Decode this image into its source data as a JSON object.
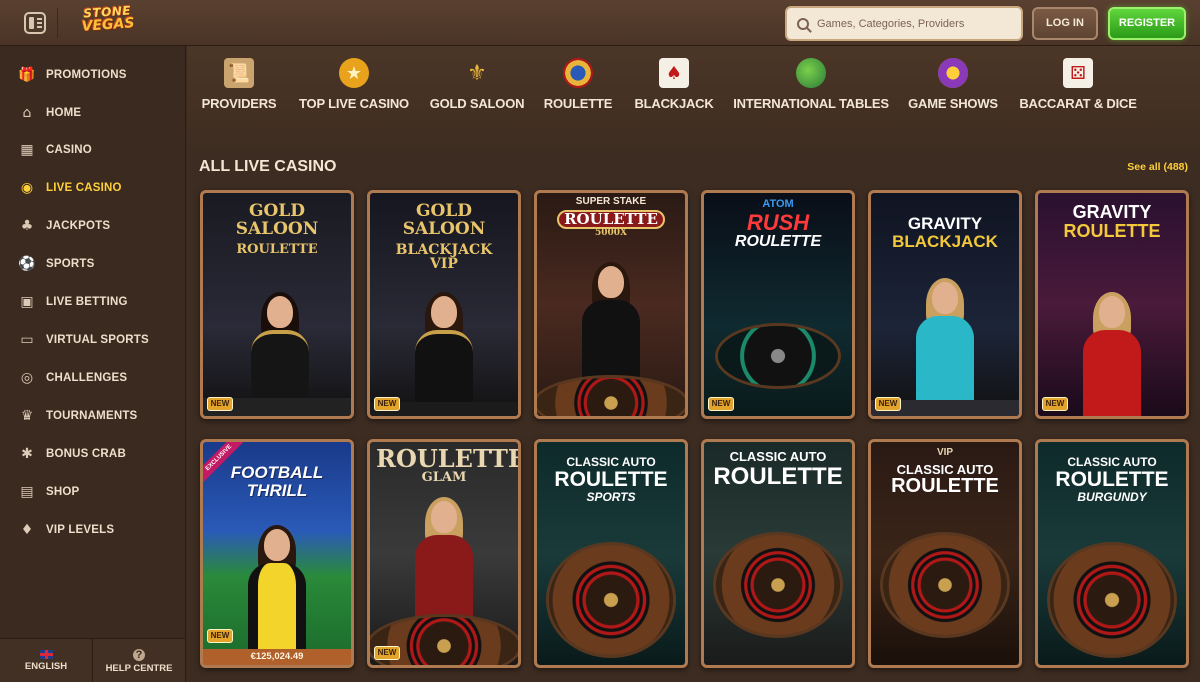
{
  "header": {
    "logo_line1": "STONE",
    "logo_line2": "VEGAS",
    "search_placeholder": "Games, Categories, Providers",
    "login_label": "LOG IN",
    "register_label": "REGISTER",
    "icons": {
      "menu": "sidebar-toggle-icon",
      "search": "search-icon"
    }
  },
  "sidebar": {
    "items": [
      {
        "label": "PROMOTIONS",
        "icon": "gift-icon",
        "active": false
      },
      {
        "label": "HOME",
        "icon": "home-icon",
        "active": false
      },
      {
        "label": "CASINO",
        "icon": "slot-machine-icon",
        "active": false
      },
      {
        "label": "LIVE CASINO",
        "icon": "live-casino-icon",
        "active": true
      },
      {
        "label": "JACKPOTS",
        "icon": "clover-icon",
        "active": false
      },
      {
        "label": "SPORTS",
        "icon": "ball-icon",
        "active": false
      },
      {
        "label": "LIVE BETTING",
        "icon": "live-betting-icon",
        "active": false
      },
      {
        "label": "VIRTUAL SPORTS",
        "icon": "virtual-sports-icon",
        "active": false
      },
      {
        "label": "CHALLENGES",
        "icon": "target-icon",
        "active": false
      },
      {
        "label": "TOURNAMENTS",
        "icon": "trophy-icon",
        "active": false
      },
      {
        "label": "BONUS CRAB",
        "icon": "crab-icon",
        "active": false
      },
      {
        "label": "SHOP",
        "icon": "shop-icon",
        "active": false
      },
      {
        "label": "VIP LEVELS",
        "icon": "vip-icon",
        "active": false
      }
    ],
    "footer": {
      "language_label": "ENGLISH",
      "help_label": "HELP CENTRE"
    }
  },
  "categories": [
    {
      "label": "PROVIDERS",
      "icon": "scroll-icon"
    },
    {
      "label": "TOP LIVE CASINO",
      "icon": "crown-badge-icon"
    },
    {
      "label": "GOLD SALOON",
      "icon": "fleur-de-lis-icon"
    },
    {
      "label": "ROULETTE",
      "icon": "roulette-icon"
    },
    {
      "label": "BLACKJACK",
      "icon": "cards-icon"
    },
    {
      "label": "INTERNATIONAL TABLES",
      "icon": "globe-icon"
    },
    {
      "label": "GAME SHOWS",
      "icon": "game-show-icon"
    },
    {
      "label": "BACCARAT & DICE",
      "icon": "dice-cards-icon"
    }
  ],
  "section": {
    "title": "ALL LIVE CASINO",
    "see_all": "See all (488)"
  },
  "games": [
    {
      "line1": "GOLD SALOON",
      "line2": "ROULETTE",
      "line3": "",
      "badge": "NEW"
    },
    {
      "line1": "GOLD SALOON",
      "line2": "BLACKJACK",
      "line3": "VIP",
      "badge": "NEW"
    },
    {
      "line1": "SUPER STAKE",
      "line2": "ROULETTE",
      "line3": "5000X",
      "badge": ""
    },
    {
      "line1": "ATOM",
      "line2": "RUSH",
      "line3": "ROULETTE",
      "badge": "NEW"
    },
    {
      "line1": "GRAVITY",
      "line2": "BLACKJACK",
      "line3": "",
      "badge": "NEW"
    },
    {
      "line1": "GRAVITY",
      "line2": "ROULETTE",
      "line3": "",
      "badge": "NEW"
    },
    {
      "line1": "FOOTBALL",
      "line2": "THRILL",
      "line3": "",
      "badge": "NEW",
      "ribbon": "EXCLUSIVE",
      "jackpot": "€125,024.49"
    },
    {
      "line1": "ROULETTE",
      "line2": "GLAM",
      "line3": "",
      "badge": "NEW"
    },
    {
      "line1": "CLASSIC AUTO",
      "line2": "ROULETTE",
      "line3": "SPORTS",
      "badge": ""
    },
    {
      "line1": "CLASSIC AUTO",
      "line2": "ROULETTE",
      "line3": "",
      "badge": ""
    },
    {
      "line1": "VIP",
      "line2": "CLASSIC AUTO",
      "line3": "ROULETTE",
      "badge": ""
    },
    {
      "line1": "CLASSIC AUTO",
      "line2": "ROULETTE",
      "line3": "BURGUNDY",
      "badge": ""
    }
  ],
  "colors": {
    "accent": "#ffcf3a",
    "register_green": "#3fbf24",
    "tile_border": "#b07a50",
    "new_badge": "#e2a42a"
  }
}
